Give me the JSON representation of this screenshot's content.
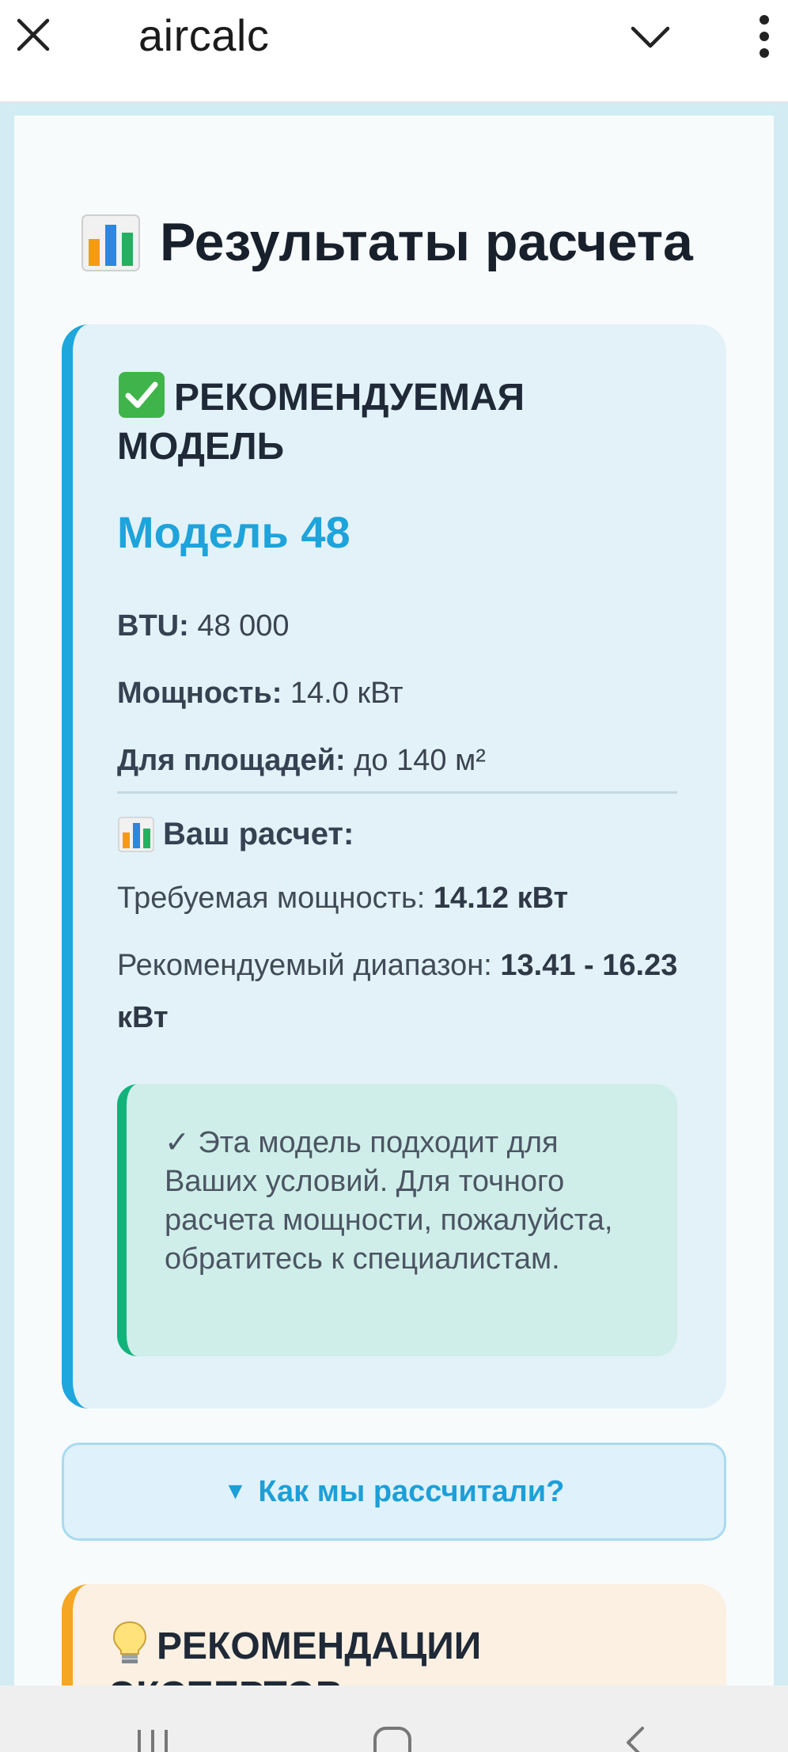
{
  "app": {
    "title": "aircalc"
  },
  "page": {
    "title": "Результаты расчета"
  },
  "result": {
    "header": "РЕКОМЕНДУЕМАЯ МОДЕЛЬ",
    "model_name": "Модель 48",
    "specs": [
      {
        "label": "BTU:",
        "value": "48 000"
      },
      {
        "label": "Мощность:",
        "value": "14.0 кВт"
      },
      {
        "label": "Для площадей:",
        "value": "до 140 м²"
      }
    ],
    "calc_header": "Ваш расчет:",
    "required_label": "Требуемая мощность:",
    "required_value": "14.12 кВт",
    "range_label": "Рекомендуемый диапазон:",
    "range_value": "13.41 - 16.23 кВт",
    "note": "✓ Эта модель подходит для Ваших условий. Для точного расчета мощности, пожалуйста, обратитесь к специалистам."
  },
  "how_button": {
    "arrow": "▼",
    "label": "Как мы рассчитали?"
  },
  "expert": {
    "header": "РЕКОМЕНДАЦИИ ЭКСПЕРТОВ:"
  },
  "colors": {
    "accent": "#1ea6dd",
    "success": "#12b37a",
    "warning": "#f5a623"
  },
  "icons": [
    "close-icon",
    "chevron-down-icon",
    "more-vert-icon",
    "bar-chart-icon",
    "check-mark-icon",
    "light-bulb-icon",
    "recent-apps-icon",
    "home-icon",
    "back-icon"
  ]
}
